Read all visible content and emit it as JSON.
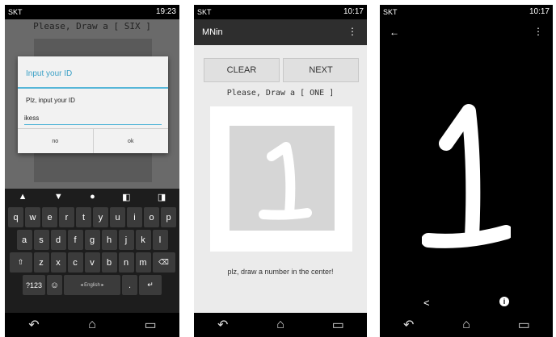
{
  "screen1": {
    "status": {
      "carrier": "SKT",
      "time": "19:23"
    },
    "prompt": "Please, Draw a [ SIX ]",
    "dialog": {
      "title": "Input your ID",
      "message": "Plz, input your ID",
      "input_value": "ikess",
      "no_label": "no",
      "ok_label": "ok"
    },
    "keyboard": {
      "row1": [
        "q",
        "w",
        "e",
        "r",
        "t",
        "y",
        "u",
        "i",
        "o",
        "p"
      ],
      "row2": [
        "a",
        "s",
        "d",
        "f",
        "g",
        "h",
        "j",
        "k",
        "l"
      ],
      "row3": [
        "z",
        "x",
        "c",
        "v",
        "b",
        "n",
        "m"
      ],
      "symbols_label": "?123",
      "language_label": "◂ English ▸"
    }
  },
  "screen2": {
    "status": {
      "carrier": "SKT",
      "time": "10:17"
    },
    "app_title": "MNin",
    "clear_label": "CLEAR",
    "next_label": "NEXT",
    "prompt": "Please, Draw a [ ONE ]",
    "hint": "plz, draw a number in the center!"
  },
  "screen3": {
    "status": {
      "carrier": "SKT",
      "time": "10:17"
    }
  },
  "icons": {
    "back": "arrow-left-icon",
    "menu": "overflow-menu-icon",
    "share": "share-icon",
    "info": "info-icon",
    "nav_back": "nav-back-icon",
    "nav_home": "nav-home-icon",
    "nav_recents": "nav-recents-icon"
  }
}
